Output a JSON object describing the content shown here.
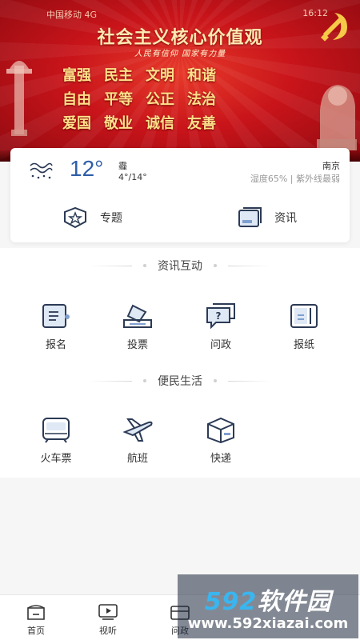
{
  "banner": {
    "statusbar_left": "中国移动 4G",
    "statusbar_right": "16:12",
    "title": "社会主义核心价值观",
    "slogan": "人民有信仰 国家有力量",
    "values_row1": [
      "富强",
      "民主",
      "文明",
      "和谐"
    ],
    "values_row2": [
      "自由",
      "平等",
      "公正",
      "法治"
    ],
    "values_row3": [
      "爱国",
      "敬业",
      "诚信",
      "友善"
    ]
  },
  "weather": {
    "temperature": "12°",
    "condition": "霾",
    "range": "4°/14°",
    "city": "南京",
    "details": "湿度65% | 紫外线最弱",
    "icon": "haze-icon"
  },
  "quick_actions": [
    {
      "label": "专题",
      "icon": "topic-badge-icon"
    },
    {
      "label": "资讯",
      "icon": "news-frame-icon"
    }
  ],
  "sections": [
    {
      "title": "资讯互动",
      "items": [
        {
          "label": "报名",
          "icon": "signup-form-icon"
        },
        {
          "label": "投票",
          "icon": "vote-box-icon"
        },
        {
          "label": "问政",
          "icon": "question-chat-icon"
        },
        {
          "label": "报纸",
          "icon": "newspaper-icon"
        }
      ]
    },
    {
      "title": "便民生活",
      "items": [
        {
          "label": "火车票",
          "icon": "train-icon"
        },
        {
          "label": "航班",
          "icon": "airplane-icon"
        },
        {
          "label": "快递",
          "icon": "parcel-box-icon"
        }
      ]
    }
  ],
  "bottom_nav": [
    {
      "label": "首页",
      "icon": "home-icon"
    },
    {
      "label": "视听",
      "icon": "play-video-icon"
    },
    {
      "label": "问政",
      "icon": "inbox-icon"
    }
  ],
  "watermark": {
    "brand_num": "592",
    "brand_text": "软件园",
    "url": "www.592xiazai.com"
  },
  "colors": {
    "accent": "#2f5ea8",
    "banner_red": "#c8141a",
    "icon_navy": "#2b3a55"
  }
}
